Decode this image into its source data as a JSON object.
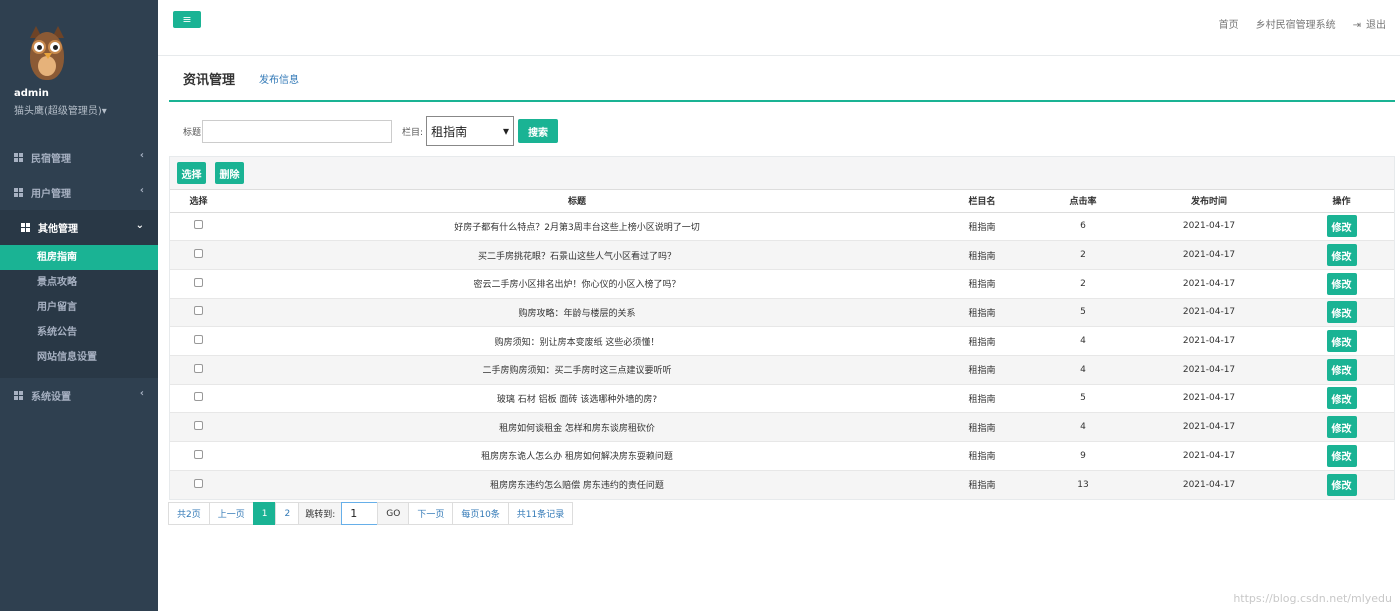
{
  "sidebar": {
    "username": "admin",
    "role": "猫头鹰(超级管理员)▾",
    "groups": [
      {
        "label": "民宿管理",
        "arrow": "‹"
      },
      {
        "label": "用户管理",
        "arrow": "‹"
      },
      {
        "label": "其他管理",
        "arrow": "⌄"
      },
      {
        "label": "系统设置",
        "arrow": "‹"
      }
    ],
    "subitems": [
      "租房指南",
      "景点攻略",
      "用户留言",
      "系统公告",
      "网站信息设置"
    ]
  },
  "topbar": {
    "menu_icon": "≡",
    "home": "首页",
    "system": "乡村民宿管理系统",
    "logout": "退出"
  },
  "page": {
    "title": "资讯管理",
    "publish_link": "发布信息"
  },
  "search": {
    "title_label": "标题",
    "title_value": "",
    "column_label": "栏目:",
    "column_value": "租指南",
    "search_button": "搜索"
  },
  "toolbar": {
    "select_button": "选择",
    "delete_button": "删除"
  },
  "table": {
    "headers": [
      "选择",
      "标题",
      "栏目名",
      "点击率",
      "发布时间",
      "操作"
    ],
    "edit_label": "修改",
    "rows": [
      {
        "title": "好房子都有什么特点？2月第3周丰台这些上榜小区说明了一切",
        "column": "租指南",
        "clicks": "6",
        "date": "2021-04-17"
      },
      {
        "title": "买二手房挑花眼？石景山这些人气小区看过了吗？",
        "column": "租指南",
        "clicks": "2",
        "date": "2021-04-17"
      },
      {
        "title": "密云二手房小区排名出炉！你心仪的小区入榜了吗？",
        "column": "租指南",
        "clicks": "2",
        "date": "2021-04-17"
      },
      {
        "title": "购房攻略：年龄与楼层的关系",
        "column": "租指南",
        "clicks": "5",
        "date": "2021-04-17"
      },
      {
        "title": "购房须知：别让房本变废纸 这些必须懂！",
        "column": "租指南",
        "clicks": "4",
        "date": "2021-04-17"
      },
      {
        "title": "二手房购房须知：买二手房时这三点建议要听听",
        "column": "租指南",
        "clicks": "4",
        "date": "2021-04-17"
      },
      {
        "title": "玻璃 石材 铝板 面砖 该选哪种外墙的房?",
        "column": "租指南",
        "clicks": "5",
        "date": "2021-04-17"
      },
      {
        "title": "租房如何谈租金 怎样和房东谈房租砍价",
        "column": "租指南",
        "clicks": "4",
        "date": "2021-04-17"
      },
      {
        "title": "租房房东诡人怎么办 租房如何解决房东耍赖问题",
        "column": "租指南",
        "clicks": "9",
        "date": "2021-04-17"
      },
      {
        "title": "租房房东违约怎么赔偿 房东违约的责任问题",
        "column": "租指南",
        "clicks": "13",
        "date": "2021-04-17"
      }
    ]
  },
  "pager": {
    "total_pages": "共2页",
    "prev": "上一页",
    "page1": "1",
    "page2": "2",
    "jump_label": "跳转到:",
    "jump_value": "1",
    "go": "GO",
    "next": "下一页",
    "per_page": "每页10条",
    "total_records": "共11条记录"
  },
  "watermark": "https://blog.csdn.net/mlyedu",
  "colors": {
    "accent": "#1ab394",
    "sidebar": "#2f4050",
    "link": "#337ab7"
  }
}
